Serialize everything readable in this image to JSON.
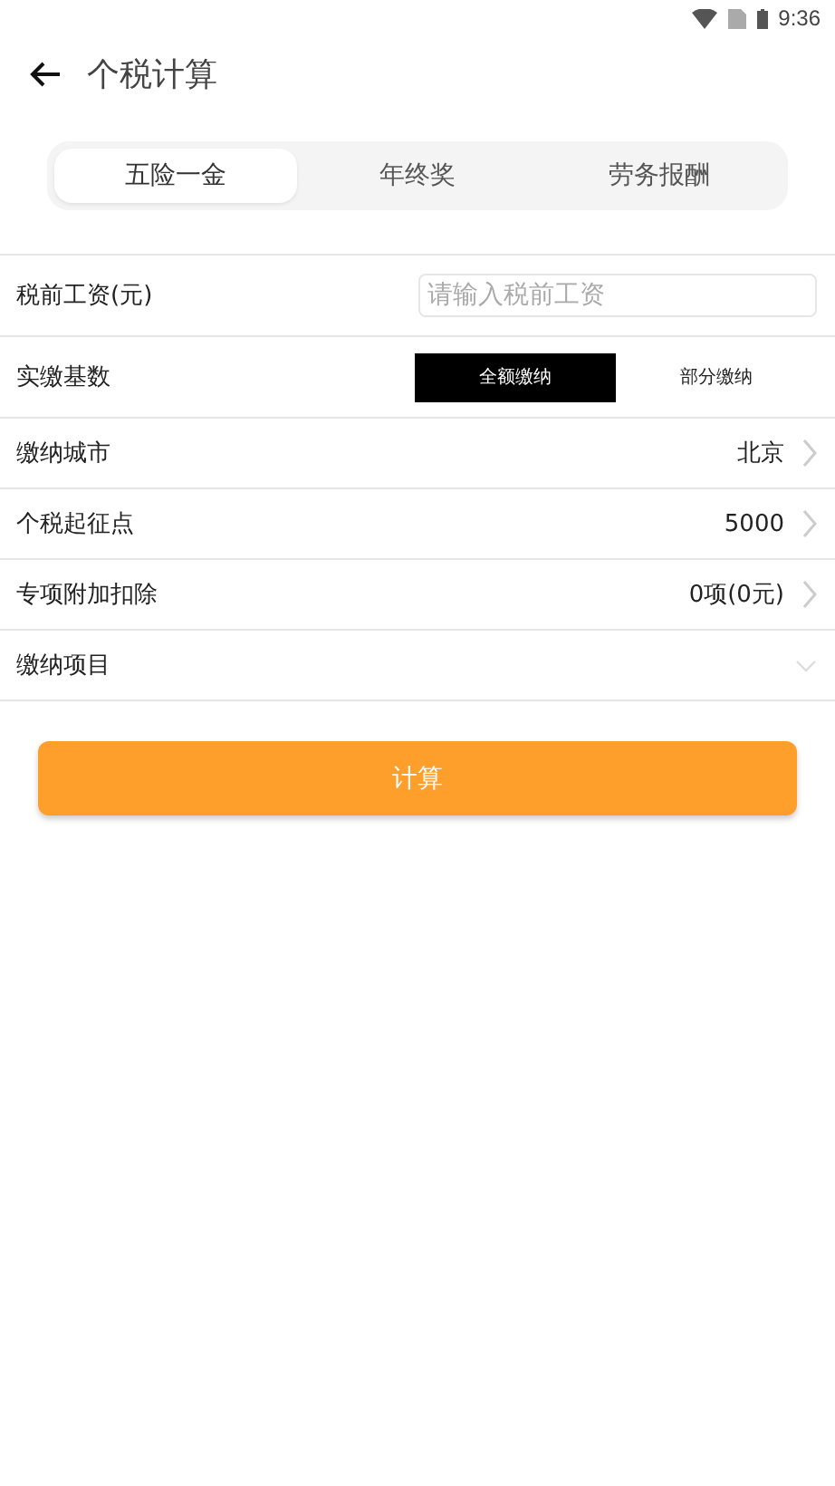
{
  "status_bar": {
    "time": "9:36"
  },
  "header": {
    "title": "个税计算"
  },
  "tabs": [
    {
      "label": "五险一金",
      "selected": true
    },
    {
      "label": "年终奖",
      "selected": false
    },
    {
      "label": "劳务报酬",
      "selected": false
    }
  ],
  "rows": [
    {
      "kind": "input",
      "label": "税前工资(元)",
      "placeholder": "请输入税前工资"
    },
    {
      "kind": "segmented",
      "label": "实缴基数",
      "options": [
        {
          "label": "全额缴纳",
          "selected": true
        },
        {
          "label": "部分缴纳",
          "selected": false
        }
      ]
    },
    {
      "kind": "link",
      "label": "缴纳城市",
      "value": "北京"
    },
    {
      "kind": "link",
      "label": "个税起征点",
      "value": "5000"
    },
    {
      "kind": "link",
      "label": "专项附加扣除",
      "value": "0项(0元)"
    },
    {
      "kind": "expand",
      "label": "缴纳项目",
      "expanded": false
    }
  ],
  "button": {
    "label": "计算"
  }
}
